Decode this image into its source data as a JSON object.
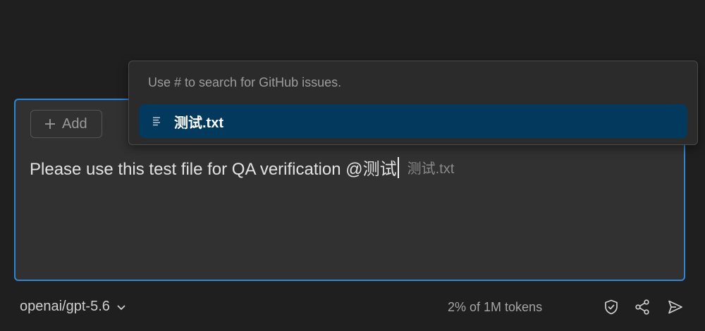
{
  "popup": {
    "hint": "Use # to search for GitHub issues.",
    "items": [
      {
        "label": "测试.txt",
        "icon": "file-lines-icon",
        "selected": true
      }
    ]
  },
  "composer": {
    "add_label": "Add",
    "message_text": "Please use this test file for QA verification @测试",
    "ghost_suggestion": "测试.txt"
  },
  "footer": {
    "model": "openai/gpt-5.6",
    "token_usage": "2% of 1M tokens"
  },
  "colors": {
    "accent_border": "#2f86d6",
    "selected_item_bg": "#04395e",
    "background": "#1f1f1f",
    "input_bg": "#313131"
  }
}
